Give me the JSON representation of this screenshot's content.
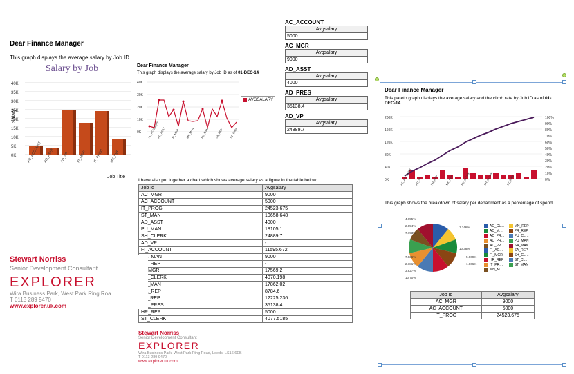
{
  "left": {
    "greeting": "Dear Finance Manager",
    "intro": "This graph displays the average salary by Job ID",
    "chart_title": "Salary by Job",
    "xlabel": "Job Title",
    "ylabel": "Salary",
    "line_intro": "Dear Finance Manager",
    "line_sub": "This graph displays the average salary by Job ID as of ",
    "line_date": "01-DEC-14",
    "line_legend": "AVGSALARY",
    "table_intro": "I have also put together a chart which shows average salary as a figure in the table below",
    "tbl_h1": "Job Id",
    "tbl_h2": "Avgsalary",
    "tbl_rows": [
      [
        "AC_MGR",
        "9000"
      ],
      [
        "AC_ACCOUNT",
        "5000"
      ],
      [
        "IT_PROG",
        "24523.675"
      ],
      [
        "ST_MAN",
        "10658.648"
      ],
      [
        "AD_ASST",
        "4000"
      ],
      [
        "PU_MAN",
        "18105.1"
      ],
      [
        "SH_CLERK",
        "24889.7"
      ],
      [
        "AD_VP",
        "-"
      ],
      [
        "FI_ACCOUNT",
        "11595.672"
      ],
      [
        "MK_MAN",
        "9000"
      ],
      [
        "PR_REP",
        "-"
      ],
      [
        "FI_MGR",
        "17569.2"
      ],
      [
        "PU_CLERK",
        "4070.198"
      ],
      [
        "SA_MAN",
        "17862.02"
      ],
      [
        "MK_REP",
        "8784.6"
      ],
      [
        "SA_REP",
        "12225.236"
      ],
      [
        "AD_PRES",
        "35138.4"
      ],
      [
        "HR_REP",
        "5000"
      ],
      [
        "ST_CLERK",
        "4077.5185"
      ]
    ]
  },
  "contact": {
    "name": "Stewart Norriss",
    "role": "Senior Development Consultant",
    "logo": "EXPLORER",
    "addr": "Wira Business Park, West Park Ring Roa",
    "tel_label": "T",
    "tel": "0113 289 9470",
    "web": "www.explorer.uk.com"
  },
  "contact2": {
    "name": "Stewart Norriss",
    "role": "Senior Development Consultant",
    "logo": "EXPLORER",
    "addr": "Wira Business Park, West Park Ring Road, Leeds, LS16 6EB",
    "tel": "T 0113 289 9470",
    "web": "www.explorer.uk.com"
  },
  "mini": {
    "h_val": "Avgsalary",
    "rows": [
      {
        "title": "AC_ACCOUNT",
        "val": "5000"
      },
      {
        "title": "AC_MGR",
        "val": "9000"
      },
      {
        "title": "AD_ASST",
        "val": "4000"
      },
      {
        "title": "AD_PRES",
        "val": "35138.4"
      },
      {
        "title": "AD_VP",
        "val": "24889.7"
      }
    ]
  },
  "right": {
    "greeting": "Dear Finance Manager",
    "intro1": "This pareto graph displays the average salary and the climb rate by Job ID as of ",
    "date": "01-DEC-14",
    "intro2": "This graph shows the breakdown of salary per department as a percentage of spend",
    "pie_labels": [
      "4.655%",
      "2.054%",
      "1.746%",
      "7.793%",
      "7.026%",
      "10.38%",
      "2.181%",
      "5.069%",
      "1.866%",
      "3.827%",
      "10.70%"
    ],
    "pie_legend": [
      "AC_CL…",
      "MN_REP",
      "AC_M…",
      "PR_REP",
      "AD_PR…",
      "PU_CL…",
      "AD_PR…",
      "PU_MAN",
      "AD_VP",
      "SA_MAN",
      "FI_AC…",
      "SA_REP",
      "FI_MGR",
      "SH_CL…",
      "HR_REP",
      "ST_CL…",
      "IT_PR…",
      "ST_MAN",
      "MN_M…"
    ],
    "tbl_h1": "Job Id",
    "tbl_h2": "Avgsalary",
    "tbl_rows": [
      [
        "AC_MGR",
        "9000"
      ],
      [
        "AC_ACCOUNT",
        "5000"
      ],
      [
        "IT_PROG",
        "24523.675"
      ]
    ]
  },
  "chart_data": [
    {
      "type": "bar",
      "title": "Salary by Job",
      "xlabel": "Job Title",
      "ylabel": "Salary",
      "ylim": [
        0,
        40000
      ],
      "yticks": [
        "0K",
        "5K",
        "10K",
        "15K",
        "20K",
        "25K",
        "30K",
        "35K",
        "40K"
      ],
      "categories": [
        "AC_ACCOUNT",
        "AD_ASST",
        "AD_VP",
        "FI_MGR",
        "IT_PROG",
        "MK_REP"
      ],
      "values": [
        5000,
        4000,
        25000,
        17500,
        24500,
        8800
      ]
    },
    {
      "type": "line",
      "title": "Average salary by Job ID",
      "ylim": [
        0,
        40000
      ],
      "yticks": [
        "0K",
        "10K",
        "20K",
        "30K",
        "40K"
      ],
      "series": [
        {
          "name": "AVGSALARY",
          "values": [
            5000,
            4000,
            25000,
            25000,
            11500,
            17500,
            5000,
            24500,
            9000,
            8800,
            9000,
            18000,
            4000,
            18000,
            12000,
            24800,
            10600,
            4000,
            8000
          ]
        }
      ],
      "categories": [
        "AC_ACCOUNT",
        "AD_ASST",
        "AD_PRES",
        "AD_VP",
        "FI_ACCOUNT",
        "FI_MGR",
        "HR_REP",
        "IT_PROG",
        "MK_MAN",
        "MK_REP",
        "PR_REP",
        "PU_MAN",
        "PU_CLERK",
        "SA_MAN",
        "SA_REP",
        "SH_CLERK",
        "ST_MAN",
        "ST_CLERK",
        "OTHER"
      ]
    },
    {
      "type": "pareto",
      "ylim_left": [
        0,
        200000
      ],
      "ylim_right": [
        0,
        100
      ],
      "yticks_left": [
        "0K",
        "40K",
        "80K",
        "120K",
        "160K",
        "200K"
      ],
      "yticks_right": [
        "0%",
        "10%",
        "20%",
        "30%",
        "40%",
        "50%",
        "60%",
        "70%",
        "80%",
        "90%",
        "100%"
      ],
      "categories": [
        "AC_ACCOUNT",
        "AD_VP",
        "HR_REP",
        "MK_REP",
        "PU_CLERK",
        "SH_CLERK",
        "ST_MAN",
        "AD_ASST",
        "AD_PRES",
        "FI_MGR",
        "MK_MAN",
        "PR_REP",
        "SA_MAN",
        "SA_REP",
        "FI_ACCOUNT",
        "PU_MAN",
        "ST_CLERK",
        "IT_PROG"
      ],
      "bar_values": [
        5000,
        25000,
        5000,
        8800,
        4000,
        24800,
        10600,
        4000,
        35000,
        17500,
        9000,
        9000,
        18000,
        12000,
        11500,
        18000,
        4000,
        24500
      ],
      "cum_pct": [
        5,
        12,
        18,
        24,
        30,
        37,
        44,
        50,
        57,
        63,
        69,
        74,
        79,
        84,
        89,
        93,
        97,
        100
      ]
    },
    {
      "type": "pie",
      "title": "Salary per department",
      "slices": [
        4.655,
        2.054,
        1.746,
        7.793,
        7.026,
        10.38,
        2.181,
        5.069,
        1.866,
        3.827,
        10.7
      ],
      "labels": [
        "AC_CL",
        "MN_REP",
        "AC_M",
        "PR_REP",
        "AD_PR",
        "PU_CL",
        "AD_PR",
        "PU_MAN",
        "AD_VP",
        "SA_MAN",
        "FI_AC",
        "SA_REP",
        "FI_MGR",
        "SH_CL",
        "HR_REP",
        "ST_CL",
        "IT_PR",
        "ST_MAN",
        "MN_M"
      ]
    }
  ]
}
